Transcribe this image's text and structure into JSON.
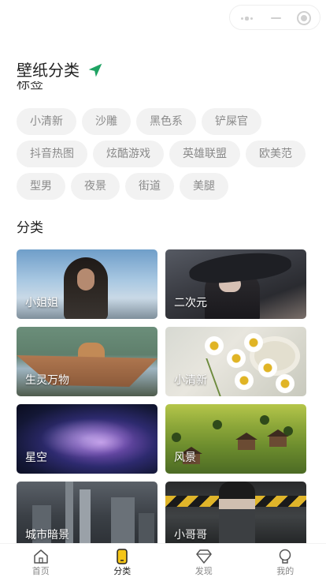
{
  "header": {
    "title": "壁纸分类"
  },
  "tags_section": {
    "label": "标签",
    "tags": [
      "小清新",
      "沙雕",
      "黑色系",
      "铲屎官",
      "抖音热图",
      "炫酷游戏",
      "英雄联盟",
      "欧美范",
      "型男",
      "夜景",
      "街道",
      "美腿"
    ]
  },
  "categories_section": {
    "title": "分类",
    "items": [
      {
        "label": "小姐姐"
      },
      {
        "label": "二次元"
      },
      {
        "label": "生灵万物"
      },
      {
        "label": "小清新"
      },
      {
        "label": "星空"
      },
      {
        "label": "风景"
      },
      {
        "label": "城市暗景"
      },
      {
        "label": "小哥哥"
      }
    ]
  },
  "tabbar": {
    "items": [
      {
        "label": "首页",
        "icon": "home-icon"
      },
      {
        "label": "分类",
        "icon": "category-icon"
      },
      {
        "label": "发现",
        "icon": "discover-icon"
      },
      {
        "label": "我的",
        "icon": "profile-icon"
      }
    ],
    "active": "分类"
  },
  "colors": {
    "accent": "#1fa363",
    "tag_bg": "#f2f2f2",
    "tag_text": "#8a8a8a",
    "active_icon": "#f5c518"
  }
}
